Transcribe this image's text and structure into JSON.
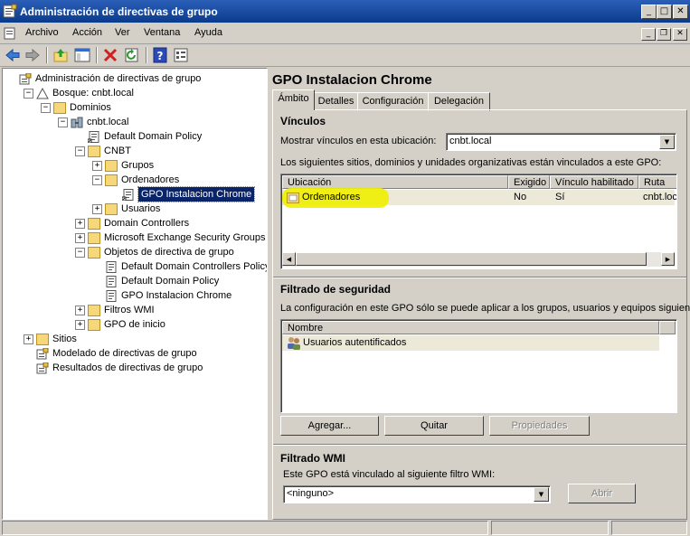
{
  "window": {
    "title": "Administración de directivas de grupo",
    "controls": [
      "minimize-icon",
      "maximize-icon",
      "close-icon"
    ]
  },
  "menu": [
    "Archivo",
    "Acción",
    "Ver",
    "Ventana",
    "Ayuda"
  ],
  "toolbar_icons": [
    "back-arrow-icon",
    "forward-arrow-icon",
    "up-folder-icon",
    "show-hide-tree-icon",
    "delete-icon",
    "refresh-icon",
    "help-icon",
    "properties-icon"
  ],
  "tree": [
    {
      "label": "Administración de directivas de grupo",
      "level": 0,
      "icon": "gpmc-icon",
      "exp": ""
    },
    {
      "label": "Bosque: cnbt.local",
      "level": 1,
      "icon": "forest-icon",
      "exp": "−"
    },
    {
      "label": "Dominios",
      "level": 2,
      "icon": "domains-folder-icon",
      "exp": "−"
    },
    {
      "label": "cnbt.local",
      "level": 3,
      "icon": "domain-icon",
      "exp": "−"
    },
    {
      "label": "Default Domain Policy",
      "level": 4,
      "icon": "gpo-link-icon",
      "exp": ""
    },
    {
      "label": "CNBT",
      "level": 4,
      "icon": "ou-folder-icon",
      "exp": "−"
    },
    {
      "label": "Grupos",
      "level": 5,
      "icon": "ou-folder-icon",
      "exp": "+"
    },
    {
      "label": "Ordenadores",
      "level": 5,
      "icon": "ou-folder-icon",
      "exp": "−"
    },
    {
      "label": "GPO Instalacion Chrome",
      "level": 6,
      "icon": "gpo-link-icon",
      "exp": "",
      "selected": true
    },
    {
      "label": "Usuarios",
      "level": 5,
      "icon": "ou-folder-icon",
      "exp": "+"
    },
    {
      "label": "Domain Controllers",
      "level": 4,
      "icon": "ou-folder-icon",
      "exp": "+"
    },
    {
      "label": "Microsoft Exchange Security Groups",
      "level": 4,
      "icon": "ou-folder-icon",
      "exp": "+"
    },
    {
      "label": "Objetos de directiva de grupo",
      "level": 4,
      "icon": "gpo-container-icon",
      "exp": "−"
    },
    {
      "label": "Default Domain Controllers Policy",
      "level": 5,
      "icon": "gpo-icon",
      "exp": ""
    },
    {
      "label": "Default Domain Policy",
      "level": 5,
      "icon": "gpo-icon",
      "exp": ""
    },
    {
      "label": "GPO Instalacion Chrome",
      "level": 5,
      "icon": "gpo-icon",
      "exp": ""
    },
    {
      "label": "Filtros WMI",
      "level": 4,
      "icon": "wmi-folder-icon",
      "exp": "+"
    },
    {
      "label": "GPO de inicio",
      "level": 4,
      "icon": "starter-gpo-folder-icon",
      "exp": "+"
    },
    {
      "label": "Sitios",
      "level": 1,
      "icon": "sites-icon",
      "exp": "+"
    },
    {
      "label": "Modelado de directivas de grupo",
      "level": 1,
      "icon": "modeling-icon",
      "exp": ""
    },
    {
      "label": "Resultados de directivas de grupo",
      "level": 1,
      "icon": "results-icon",
      "exp": ""
    }
  ],
  "details": {
    "gpo_title": "GPO Instalacion Chrome",
    "tabs": [
      "Ámbito",
      "Detalles",
      "Configuración",
      "Delegación"
    ],
    "links": {
      "heading": "Vínculos",
      "location_label": "Mostrar vínculos en esta ubicación:",
      "location_value": "cnbt.local",
      "description": "Los siguientes sitios, dominios y unidades organizativas están vinculados a este GPO:",
      "columns": [
        "Ubicación",
        "Exigido",
        "Vínculo habilitado",
        "Ruta"
      ],
      "rows": [
        {
          "location": "Ordenadores",
          "enforced": "No",
          "enabled": "Sí",
          "path": "cnbt.loc"
        }
      ],
      "highlight_color": "#f0f000"
    },
    "security": {
      "heading": "Filtrado de seguridad",
      "description": "La configuración en este GPO sólo se puede aplicar a los grupos, usuarios y equipos siguient",
      "column": "Nombre",
      "rows": [
        "Usuarios autentificados"
      ],
      "buttons": {
        "add": "Agregar...",
        "remove": "Quitar",
        "properties": "Propiedades"
      }
    },
    "wmi": {
      "heading": "Filtrado WMI",
      "description": "Este GPO está vinculado al siguiente filtro WMI:",
      "value": "<ninguno>",
      "open_button": "Abrir"
    }
  },
  "colors": {
    "title_bar": "#0a3a8c",
    "selection": "#0a246a",
    "folder": "#f6d77a"
  }
}
